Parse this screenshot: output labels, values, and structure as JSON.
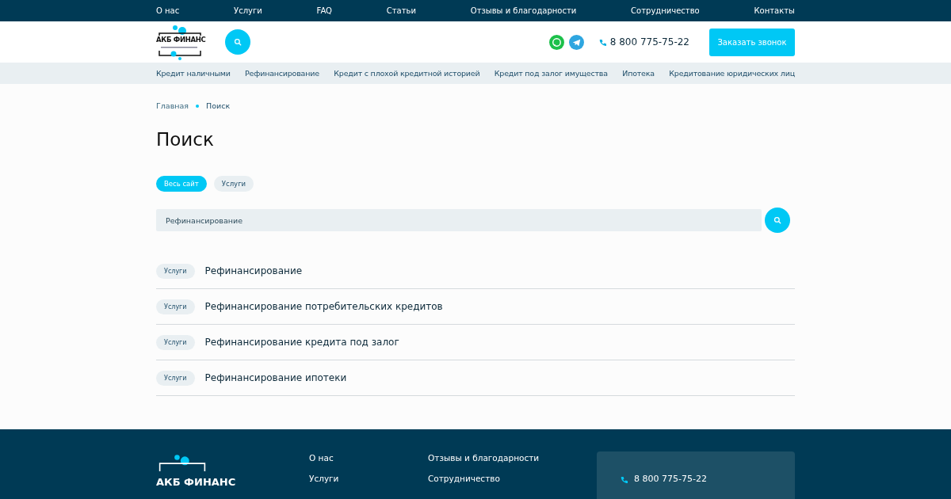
{
  "top_nav": [
    {
      "label": "О нас"
    },
    {
      "label": "Услуги"
    },
    {
      "label": "FAQ"
    },
    {
      "label": "Статьи"
    },
    {
      "label": "Отзывы и благодарности"
    },
    {
      "label": "Сотрудничество"
    },
    {
      "label": "Контакты"
    }
  ],
  "header": {
    "logo_text": "АКБ ФИНАНС",
    "phone": "8 800 775-75-22",
    "cta": "Заказать звонок"
  },
  "category_nav": [
    {
      "label": "Кредит наличными"
    },
    {
      "label": "Рефинансирование"
    },
    {
      "label": "Кредит с плохой кредитной историей"
    },
    {
      "label": "Кредит под залог имущества"
    },
    {
      "label": "Ипотека"
    },
    {
      "label": "Кредитование юридических лиц"
    }
  ],
  "breadcrumbs": [
    "Главная",
    "Поиск"
  ],
  "title": "Поиск",
  "filters": [
    {
      "label": "Весь сайт",
      "selected": true
    },
    {
      "label": "Услуги",
      "selected": false
    }
  ],
  "search": {
    "value": "Рефинансирование"
  },
  "results": [
    {
      "tag": "Услуги",
      "title": "Рефинансирование"
    },
    {
      "tag": "Услуги",
      "title": "Рефинансирование потребительских кредитов"
    },
    {
      "tag": "Услуги",
      "title": "Рефинансирование кредита под залог"
    },
    {
      "tag": "Услуги",
      "title": "Рефинансирование ипотеки"
    }
  ],
  "footer": {
    "logo_text": "АКБ ФИНАНС",
    "links_col_1": [
      "О нас",
      "Услуги"
    ],
    "links_col_2": [
      "Отзывы и благодарности",
      "Сотрудничество"
    ],
    "phone": "8 800 775-75-22"
  }
}
